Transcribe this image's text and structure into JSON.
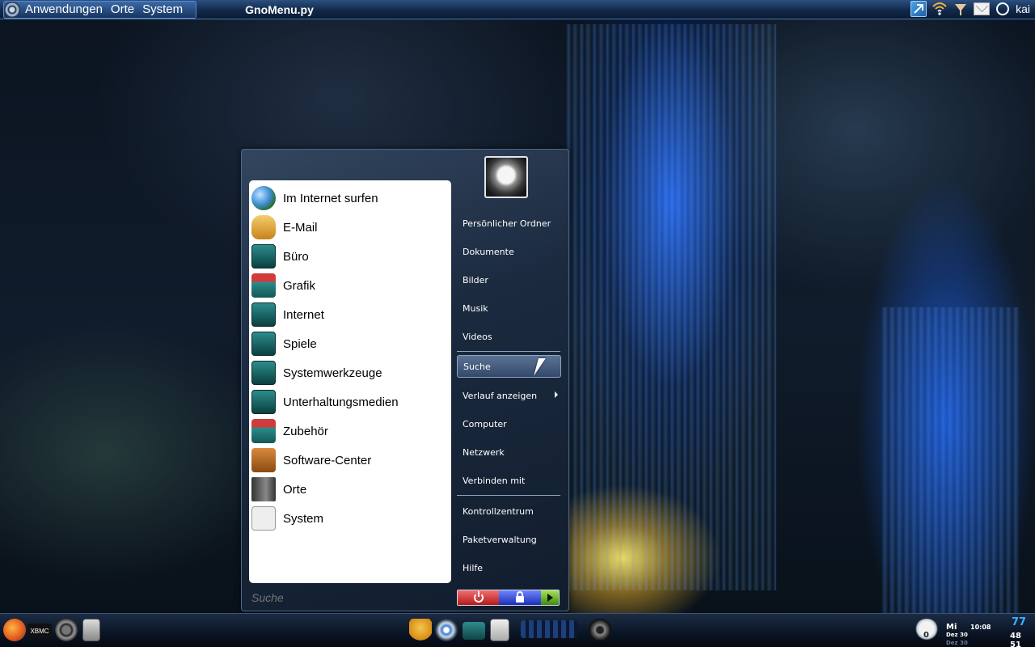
{
  "top_panel": {
    "menus": [
      "Anwendungen",
      "Orte",
      "System"
    ],
    "window_title": "GnoMenu.py",
    "tray_icons": [
      "network-icon",
      "wifi-icon",
      "download-icon",
      "mail-icon",
      "power-icon"
    ],
    "user": "kai"
  },
  "gnomenu": {
    "apps": [
      {
        "label": "Im Internet surfen",
        "icon": "globe-icon"
      },
      {
        "label": "E-Mail",
        "icon": "mail-icon"
      },
      {
        "label": "Büro",
        "icon": "folder-office-icon"
      },
      {
        "label": "Grafik",
        "icon": "folder-graphics-icon"
      },
      {
        "label": "Internet",
        "icon": "folder-internet-icon"
      },
      {
        "label": "Spiele",
        "icon": "folder-games-icon"
      },
      {
        "label": "Systemwerkzeuge",
        "icon": "folder-system-tools-icon"
      },
      {
        "label": "Unterhaltungsmedien",
        "icon": "folder-multimedia-icon"
      },
      {
        "label": "Zubehör",
        "icon": "folder-accessories-icon"
      },
      {
        "label": "Software-Center",
        "icon": "software-center-icon"
      },
      {
        "label": "Orte",
        "icon": "places-icon"
      },
      {
        "label": "System",
        "icon": "system-icon"
      }
    ],
    "search_placeholder": "Suche",
    "places_top": [
      "Persönlicher Ordner",
      "Dokumente",
      "Bilder",
      "Musik",
      "Videos"
    ],
    "places_mid": [
      "Suche",
      "Verlauf anzeigen",
      "Computer",
      "Netzwerk",
      "Verbinden mit"
    ],
    "places_bottom": [
      "Kontrollzentrum",
      "Paketverwaltung",
      "Hilfe"
    ],
    "active_item": "Suche",
    "colors": {
      "shutdown": "#c62a2a",
      "lock": "#2a3ec0",
      "run": "#5aa41e"
    }
  },
  "bottom_panel": {
    "launchers": [
      "firefox-icon",
      "xbmc-icon",
      "camera-icon",
      "file-cabinet-icon",
      "gimp-icon",
      "chromium-icon",
      "terminal-icon",
      "removable-drive-icon",
      "media-player-icon",
      "speaker-icon"
    ],
    "xbmc_label": "XBMC",
    "weather": {
      "temp": "0",
      "day": "Mi",
      "date": "Dez 30",
      "time": "10:08",
      "date2": "Dez 30"
    },
    "clock": "48 51",
    "clock_top": "77"
  }
}
